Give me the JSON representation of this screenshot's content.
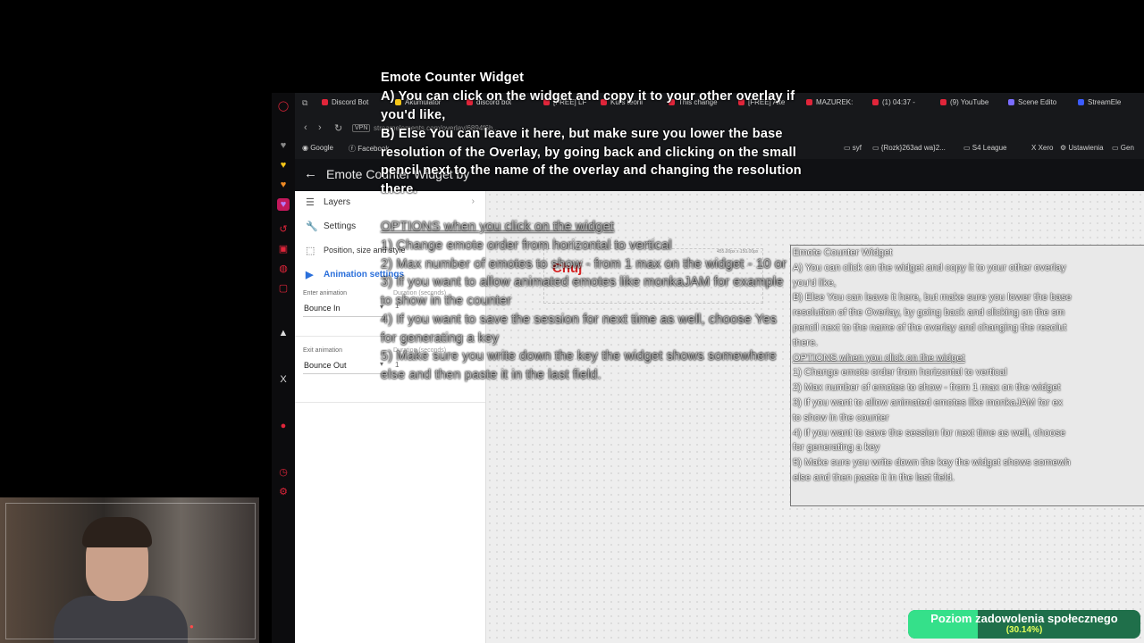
{
  "browser": {
    "tabs": [
      {
        "label": "Discord Bot"
      },
      {
        "label": "Akumulator"
      },
      {
        "label": "discord bot"
      },
      {
        "label": "[FREE] LF"
      },
      {
        "label": "Kurs teorii"
      },
      {
        "label": "This change"
      },
      {
        "label": "[FREE] Alte"
      },
      {
        "label": "MAZUREK:"
      },
      {
        "label": "(1) 04:37 -"
      },
      {
        "label": "(9) YouTube"
      },
      {
        "label": "Scene Edito"
      },
      {
        "label": "StreamEle"
      }
    ],
    "url": "streamelements.com/overlay/6894f6b...",
    "vpn_label": "VPN",
    "bookmarks": [
      {
        "label": "Google"
      },
      {
        "label": "Facebook"
      },
      {
        "label": "syf"
      },
      {
        "label": "{Rozk}263ad wa}2..."
      },
      {
        "label": "S4 League"
      },
      {
        "label": "Xero"
      },
      {
        "label": "Ustawienia"
      },
      {
        "label": "Gen"
      }
    ]
  },
  "editor": {
    "title": "Emote Counter Widget by",
    "menu": [
      {
        "label": "Layers"
      },
      {
        "label": "Settings"
      },
      {
        "label": "Position, size and style"
      },
      {
        "label": "Animation settings"
      }
    ],
    "enter_animation_label": "Enter animation",
    "enter_animation_value": "Bounce In",
    "exit_animation_label": "Exit animation",
    "exit_animation_value": "Bounce Out",
    "duration_label": "Duration (seconds)",
    "enter_duration": "1",
    "exit_duration": "1",
    "widget_dimensions": "455.00px x 150.00px",
    "widget_preview_text": "Chuj"
  },
  "overlay_text": {
    "title": "Emote Counter Widget",
    "lines_bold": [
      "A) You can click on the widget and copy it to your other overlay if",
      "you'd like,",
      "B) Else You can leave it here, but make sure you lower the base",
      "resolution of the Overlay, by going back and clicking on the small",
      "pencil next to the name of the overlay and changing the resolution",
      "there."
    ],
    "options_heading": "OPTIONS when you click on the widget",
    "options": [
      "1) Change emote order from horizontal to vertical",
      "2) Max number of emotes to show - from 1 max on the widget - 10 or",
      "3) If you want to allow animated emotes like monkaJAM for example",
      "to show in the counter",
      "4) If you want to save the session for next time as well, choose Yes",
      "for generating a key",
      "5) Make sure you write down the key the widget shows somewhere",
      "else and then paste it in the last field."
    ]
  },
  "canvas_note": {
    "title": "Emote Counter Widget",
    "lines": [
      "A) You can click on the widget and copy it to your other overlay",
      "you'd like,",
      "B) Else You can leave it here, but make sure you lower the base",
      "resolution of the Overlay, by going back and clicking on the sm",
      "pencil next to the name of the overlay and changing the resolut",
      "there."
    ],
    "options_heading": "OPTIONS when you click on the widget",
    "options": [
      "1) Change emote order from horizontal to vertical",
      "2) Max number of emotes to show - from 1 max on the widget",
      "3) If you want to allow animated emotes like monkaJAM for ex",
      "to show in the counter",
      "4) If you want to save the session for next time as well, choose",
      "for generating a key",
      "5) Make sure you write down the key the widget shows somewh",
      "else and then paste it in the last field."
    ]
  },
  "social_meter": {
    "title": "Poziom zadowolenia społecznego",
    "percent_label": "(30.14%)",
    "percent": 30.14,
    "fill_color": "#35e08a"
  }
}
